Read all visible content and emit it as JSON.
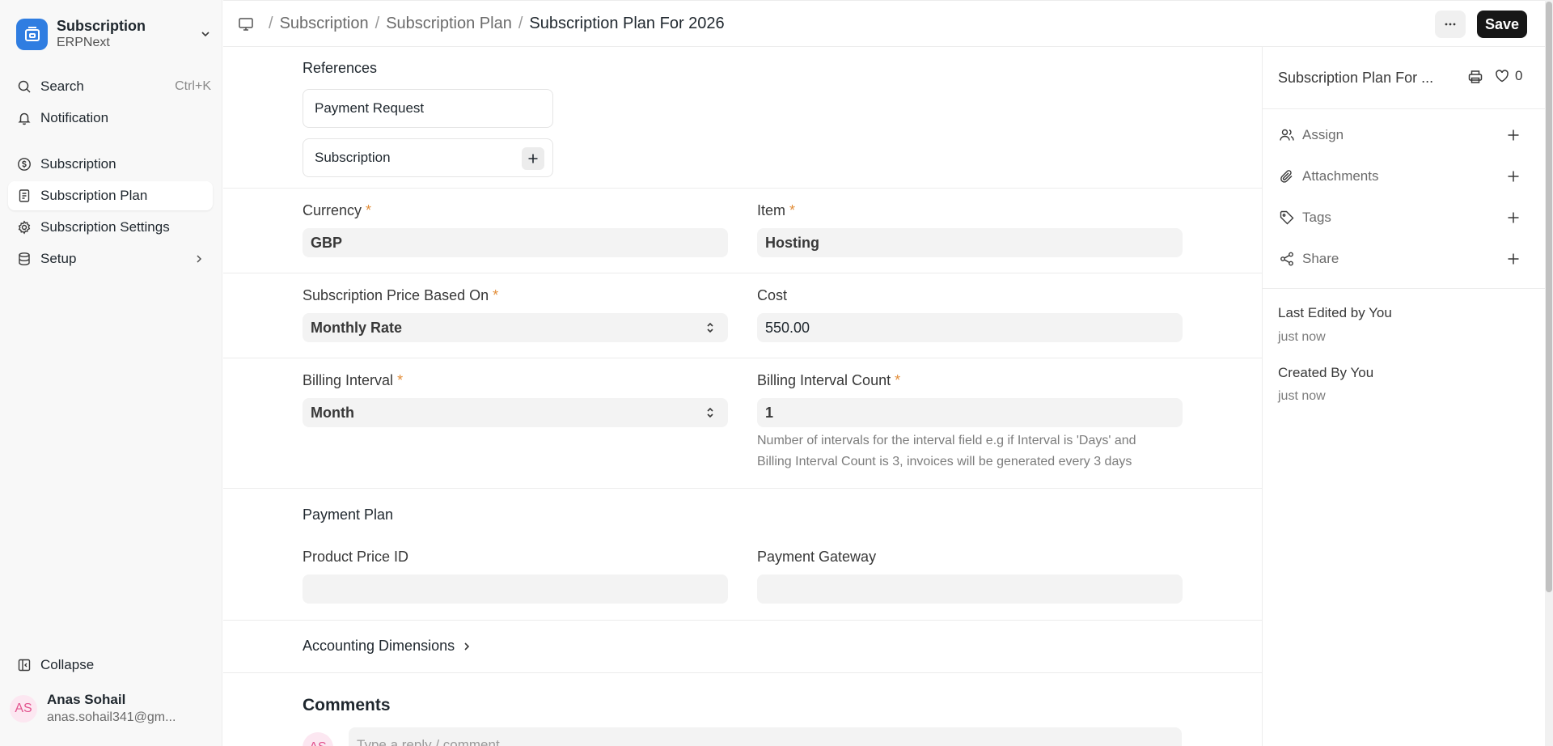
{
  "workspace": {
    "title": "Subscription",
    "subtitle": "ERPNext",
    "accent_color": "#2f7de1"
  },
  "sidebar": {
    "search_label": "Search",
    "search_shortcut": "Ctrl+K",
    "notification_label": "Notification",
    "items": [
      {
        "label": "Subscription",
        "icon": "dollar-circle-icon"
      },
      {
        "label": "Subscription Plan",
        "icon": "document-icon",
        "active": true
      },
      {
        "label": "Subscription Settings",
        "icon": "gear-icon"
      },
      {
        "label": "Setup",
        "icon": "database-icon"
      }
    ],
    "collapse_label": "Collapse",
    "user": {
      "initials": "AS",
      "name": "Anas Sohail",
      "email": "anas.sohail341@gm..."
    }
  },
  "header": {
    "breadcrumbs": [
      "Subscription",
      "Subscription Plan"
    ],
    "current": "Subscription Plan For 2026",
    "save_label": "Save"
  },
  "form": {
    "references": {
      "title": "References",
      "items": [
        "Payment Request",
        "Subscription"
      ]
    },
    "currency": {
      "label": "Currency",
      "value": "GBP"
    },
    "item": {
      "label": "Item",
      "value": "Hosting"
    },
    "price_based_on": {
      "label": "Subscription Price Based On",
      "value": "Monthly Rate"
    },
    "cost": {
      "label": "Cost",
      "value": "550.00"
    },
    "billing_interval": {
      "label": "Billing Interval",
      "value": "Month"
    },
    "billing_interval_count": {
      "label": "Billing Interval Count",
      "value": "1",
      "description_line1": "Number of intervals for the interval field e.g if Interval is 'Days' and",
      "description_line2": "Billing Interval Count is 3, invoices will be generated every 3 days"
    },
    "payment_plan": {
      "title": "Payment Plan",
      "product_price_id_label": "Product Price ID",
      "product_price_id_value": "",
      "payment_gateway_label": "Payment Gateway",
      "payment_gateway_value": ""
    },
    "accounting_dimensions_label": "Accounting Dimensions",
    "required_mark": "*"
  },
  "comments": {
    "title": "Comments",
    "avatar_initials": "AS",
    "placeholder": "Type a reply / comment"
  },
  "right_panel": {
    "title": "Subscription Plan For ...",
    "like_count": "0",
    "actions": [
      {
        "label": "Assign",
        "icon": "users-icon"
      },
      {
        "label": "Attachments",
        "icon": "paperclip-icon"
      },
      {
        "label": "Tags",
        "icon": "tag-icon"
      },
      {
        "label": "Share",
        "icon": "share-icon"
      }
    ],
    "last_edited_label": "Last Edited by You",
    "last_edited_time": "just now",
    "created_label": "Created By You",
    "created_time": "just now"
  }
}
